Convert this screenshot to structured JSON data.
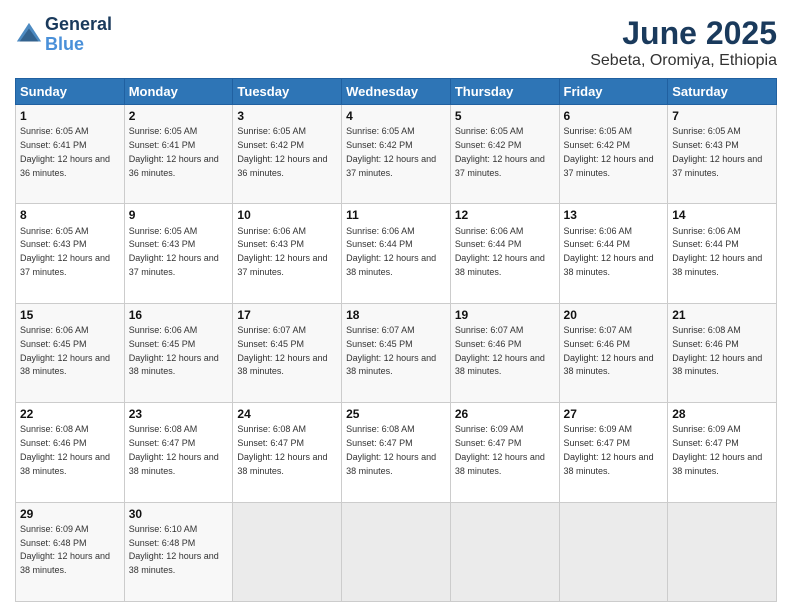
{
  "logo": {
    "line1": "General",
    "line2": "Blue"
  },
  "title": "June 2025",
  "subtitle": "Sebeta, Oromiya, Ethiopia",
  "weekdays": [
    "Sunday",
    "Monday",
    "Tuesday",
    "Wednesday",
    "Thursday",
    "Friday",
    "Saturday"
  ],
  "weeks": [
    [
      {
        "day": 1,
        "sunrise": "6:05 AM",
        "sunset": "6:41 PM",
        "daylight": "12 hours and 36 minutes"
      },
      {
        "day": 2,
        "sunrise": "6:05 AM",
        "sunset": "6:41 PM",
        "daylight": "12 hours and 36 minutes"
      },
      {
        "day": 3,
        "sunrise": "6:05 AM",
        "sunset": "6:42 PM",
        "daylight": "12 hours and 36 minutes"
      },
      {
        "day": 4,
        "sunrise": "6:05 AM",
        "sunset": "6:42 PM",
        "daylight": "12 hours and 37 minutes"
      },
      {
        "day": 5,
        "sunrise": "6:05 AM",
        "sunset": "6:42 PM",
        "daylight": "12 hours and 37 minutes"
      },
      {
        "day": 6,
        "sunrise": "6:05 AM",
        "sunset": "6:42 PM",
        "daylight": "12 hours and 37 minutes"
      },
      {
        "day": 7,
        "sunrise": "6:05 AM",
        "sunset": "6:43 PM",
        "daylight": "12 hours and 37 minutes"
      }
    ],
    [
      {
        "day": 8,
        "sunrise": "6:05 AM",
        "sunset": "6:43 PM",
        "daylight": "12 hours and 37 minutes"
      },
      {
        "day": 9,
        "sunrise": "6:05 AM",
        "sunset": "6:43 PM",
        "daylight": "12 hours and 37 minutes"
      },
      {
        "day": 10,
        "sunrise": "6:06 AM",
        "sunset": "6:43 PM",
        "daylight": "12 hours and 37 minutes"
      },
      {
        "day": 11,
        "sunrise": "6:06 AM",
        "sunset": "6:44 PM",
        "daylight": "12 hours and 38 minutes"
      },
      {
        "day": 12,
        "sunrise": "6:06 AM",
        "sunset": "6:44 PM",
        "daylight": "12 hours and 38 minutes"
      },
      {
        "day": 13,
        "sunrise": "6:06 AM",
        "sunset": "6:44 PM",
        "daylight": "12 hours and 38 minutes"
      },
      {
        "day": 14,
        "sunrise": "6:06 AM",
        "sunset": "6:44 PM",
        "daylight": "12 hours and 38 minutes"
      }
    ],
    [
      {
        "day": 15,
        "sunrise": "6:06 AM",
        "sunset": "6:45 PM",
        "daylight": "12 hours and 38 minutes"
      },
      {
        "day": 16,
        "sunrise": "6:06 AM",
        "sunset": "6:45 PM",
        "daylight": "12 hours and 38 minutes"
      },
      {
        "day": 17,
        "sunrise": "6:07 AM",
        "sunset": "6:45 PM",
        "daylight": "12 hours and 38 minutes"
      },
      {
        "day": 18,
        "sunrise": "6:07 AM",
        "sunset": "6:45 PM",
        "daylight": "12 hours and 38 minutes"
      },
      {
        "day": 19,
        "sunrise": "6:07 AM",
        "sunset": "6:46 PM",
        "daylight": "12 hours and 38 minutes"
      },
      {
        "day": 20,
        "sunrise": "6:07 AM",
        "sunset": "6:46 PM",
        "daylight": "12 hours and 38 minutes"
      },
      {
        "day": 21,
        "sunrise": "6:08 AM",
        "sunset": "6:46 PM",
        "daylight": "12 hours and 38 minutes"
      }
    ],
    [
      {
        "day": 22,
        "sunrise": "6:08 AM",
        "sunset": "6:46 PM",
        "daylight": "12 hours and 38 minutes"
      },
      {
        "day": 23,
        "sunrise": "6:08 AM",
        "sunset": "6:47 PM",
        "daylight": "12 hours and 38 minutes"
      },
      {
        "day": 24,
        "sunrise": "6:08 AM",
        "sunset": "6:47 PM",
        "daylight": "12 hours and 38 minutes"
      },
      {
        "day": 25,
        "sunrise": "6:08 AM",
        "sunset": "6:47 PM",
        "daylight": "12 hours and 38 minutes"
      },
      {
        "day": 26,
        "sunrise": "6:09 AM",
        "sunset": "6:47 PM",
        "daylight": "12 hours and 38 minutes"
      },
      {
        "day": 27,
        "sunrise": "6:09 AM",
        "sunset": "6:47 PM",
        "daylight": "12 hours and 38 minutes"
      },
      {
        "day": 28,
        "sunrise": "6:09 AM",
        "sunset": "6:47 PM",
        "daylight": "12 hours and 38 minutes"
      }
    ],
    [
      {
        "day": 29,
        "sunrise": "6:09 AM",
        "sunset": "6:48 PM",
        "daylight": "12 hours and 38 minutes"
      },
      {
        "day": 30,
        "sunrise": "6:10 AM",
        "sunset": "6:48 PM",
        "daylight": "12 hours and 38 minutes"
      },
      null,
      null,
      null,
      null,
      null
    ]
  ]
}
